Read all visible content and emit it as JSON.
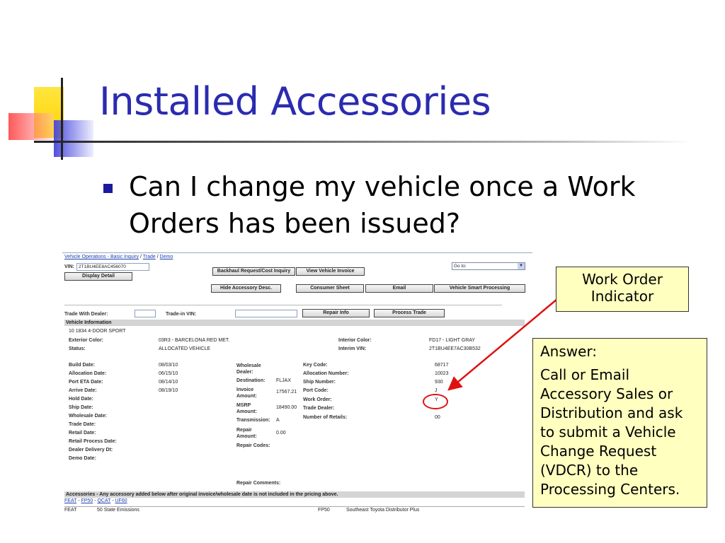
{
  "slide": {
    "title": "Installed Accessories",
    "bullet": "Can I change my vehicle once a Work Orders has been issued?"
  },
  "callouts": {
    "work_order": "Work Order Indicator",
    "answer_heading": "Answer:",
    "answer_body": "Call or Email Accessory Sales or Distribution and ask to submit a Vehicle Change Request (VDCR) to the Processing Centers."
  },
  "screenshot": {
    "breadcrumb": {
      "part1": "Vehicle Operations - Basic Inquiry",
      "sep1": " / ",
      "part2": "Trade",
      "sep2": " / ",
      "part3": "Demo"
    },
    "vin_label": "VIN:",
    "vin_value": "2T1BU4EE8AC456070",
    "buttons": {
      "display_detail": "Display Detail",
      "backhaul": "Backhaul Request/Cost Inquiry",
      "view_invoice": "View Vehicle Invoice",
      "hide_accessory": "Hide Accessory Desc.",
      "consumer_sheet": "Consumer Sheet",
      "email": "Email",
      "smart_processing": "Vehicle Smart Processing",
      "repair_info": "Repair Info",
      "process_trade": "Process Trade"
    },
    "goto_label": "Go to:",
    "trade_dealer_label": "Trade With Dealer:",
    "trade_vin_label": "Trade-in VIN:",
    "vehicle_info_header": "Vehicle Information",
    "model_line": "10  1834  4-DOOR SPORT",
    "exterior_color_label": "Exterior Color:",
    "exterior_color_value": "03R3 - BARCELONA RED MET.",
    "interior_color_label": "Interior Color:",
    "interior_color_value": "FD17 - LIGHT GRAY",
    "status_label": "Status:",
    "status_value": "ALLOCATED VEHICLE",
    "interim_vin_label": "Interim VIN:",
    "interim_vin_value": "2T1BU4EE7AC30B532",
    "dates": [
      {
        "label": "Build Date:",
        "value": "08/03/10"
      },
      {
        "label": "Allocation Date:",
        "value": "06/15/10"
      },
      {
        "label": "Port ETA Date:",
        "value": "08/14/10"
      },
      {
        "label": "Arrive Date:",
        "value": "08/19/10"
      },
      {
        "label": "Hold Date:",
        "value": ""
      },
      {
        "label": "Ship Date:",
        "value": ""
      },
      {
        "label": "Wholesale Date:",
        "value": ""
      },
      {
        "label": "Trade Date:",
        "value": ""
      },
      {
        "label": "Retail Date:",
        "value": ""
      },
      {
        "label": "Retail Process Date:",
        "value": ""
      },
      {
        "label": "Dealer Delivery Dt:",
        "value": ""
      },
      {
        "label": "Demo Date:",
        "value": ""
      }
    ],
    "mid": {
      "wholesale_label": "Wholesale Dealer:",
      "destination_label": "Destination:",
      "destination_value": "FLJAX",
      "invoice_label": "Invoice Amount:",
      "invoice_value": "17567.21",
      "msrp_label": "MSRP Amount:",
      "msrp_value": "18490.00",
      "transmission_label": "Transmission:",
      "transmission_value": "A",
      "repair_amount_label": "Repair Amount:",
      "repair_amount_value": "0.00",
      "repair_codes_label": "Repair Codes:"
    },
    "right": {
      "key_code_label": "Key Code:",
      "key_code_value": "68717",
      "allocation_number_label": "Allocation Number:",
      "allocation_number_value": "10023",
      "ship_number_label": "Ship Number:",
      "ship_number_value": "930",
      "port_code_label": "Port Code:",
      "port_code_value": "J",
      "work_order_label": "Work Order:",
      "work_order_value": "Y",
      "trade_dealer_label": "Trade Dealer:",
      "retails_label": "Number of Retails:",
      "retails_value": "00"
    },
    "repair_comments_label": "Repair Comments:",
    "accessories_header": "Accessories - Any accessory added below after original invoice/wholesale date is not included in the pricing above.",
    "accessory_links": [
      "FEAT",
      "FP50",
      "QCAT",
      "UF60"
    ],
    "accessory_rows": [
      {
        "code": "FEAT",
        "desc": "50 State Emissions",
        "code2": "FP50",
        "desc2": "Southeast Toyota Distributor Plus"
      }
    ]
  },
  "colors": {
    "title": "#2b2bb0",
    "callout_bg": "#ffffc0",
    "arrow": "#e01010"
  }
}
